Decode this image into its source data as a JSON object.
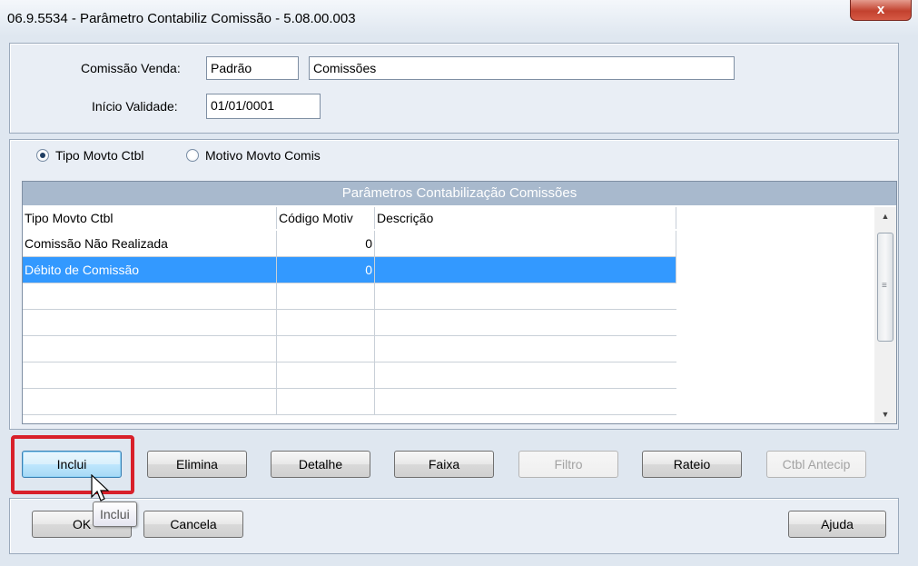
{
  "window": {
    "title": "06.9.5534 - Parâmetro Contabiliz Comissão - 5.08.00.003",
    "close_label": "x"
  },
  "header_form": {
    "comissao_venda_label": "Comissão Venda:",
    "comissao_venda_code": "Padrão",
    "comissao_venda_desc": "Comissões",
    "inicio_validade_label": "Início Validade:",
    "inicio_validade_value": "01/01/0001"
  },
  "radio_group": {
    "options": [
      {
        "label": "Tipo Movto Ctbl",
        "selected": true
      },
      {
        "label": "Motivo Movto Comis",
        "selected": false
      }
    ]
  },
  "grid": {
    "title": "Parâmetros Contabilização Comissões",
    "columns": [
      "Tipo Movto Ctbl",
      "Código Motiv",
      "Descrição"
    ],
    "rows": [
      {
        "tipo": "Comissão Não Realizada",
        "codigo": "0",
        "descricao": "",
        "selected": false
      },
      {
        "tipo": "Débito de Comissão",
        "codigo": "0",
        "descricao": "",
        "selected": true
      }
    ]
  },
  "action_buttons": {
    "inclui": "Inclui",
    "elimina": "Elimina",
    "detalhe": "Detalhe",
    "faixa": "Faixa",
    "filtro": "Filtro",
    "rateio": "Rateio",
    "ctbl_antecip": "Ctbl Antecip"
  },
  "bottom_buttons": {
    "ok": "OK",
    "cancela": "Cancela",
    "ajuda": "Ajuda"
  },
  "tooltip": {
    "text": "Inclui"
  },
  "colors": {
    "selection": "#3399ff",
    "grid_title_bg": "#a8b9cd",
    "highlight_border": "#d8202a"
  }
}
